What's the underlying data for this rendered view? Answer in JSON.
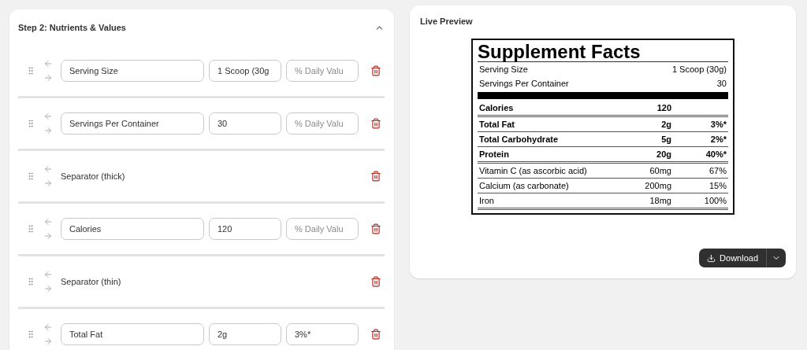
{
  "editor": {
    "title": "Step 2: Nutrients & Values",
    "expanded": true,
    "rows": [
      {
        "kind": "nutrient",
        "name": "Serving Size",
        "amount": "1 Scoop (30g",
        "daily_placeholder": "% Daily Valu"
      },
      {
        "kind": "nutrient",
        "name": "Servings Per Container",
        "amount": "30",
        "daily_placeholder": "% Daily Valu"
      },
      {
        "kind": "separator",
        "label": "Separator (thick)"
      },
      {
        "kind": "nutrient",
        "name": "Calories",
        "amount": "120",
        "daily_placeholder": "% Daily Valu"
      },
      {
        "kind": "separator",
        "label": "Separator (thin)"
      },
      {
        "kind": "nutrient",
        "name": "Total Fat",
        "amount": "2g",
        "daily": "3%*"
      }
    ]
  },
  "preview": {
    "title": "Live Preview",
    "label": {
      "title": "Supplement Facts",
      "lines": [
        {
          "kind": "serving",
          "name": "Serving Size",
          "amount": "1 Scoop (30g)"
        },
        {
          "kind": "serving",
          "name": "Servings Per Container",
          "amount": "30"
        },
        {
          "kind": "bar"
        },
        {
          "kind": "nutrient",
          "name": "Calories",
          "amount": "120",
          "bold": true,
          "double_rule": true
        },
        {
          "kind": "nutrient",
          "name": "Total Fat",
          "amount": "2g",
          "daily": "3%*",
          "bold": true,
          "double_rule": false
        },
        {
          "kind": "nutrient",
          "name": "Total Carbohydrate",
          "amount": "5g",
          "daily": "2%*",
          "bold": true,
          "double_rule": false
        },
        {
          "kind": "nutrient",
          "name": "Protein",
          "amount": "20g",
          "daily": "40%*",
          "bold": true,
          "double_rule": true
        },
        {
          "kind": "nutrient",
          "name": "Vitamin C (as ascorbic acid)",
          "amount": "60mg",
          "daily": "67%",
          "bold": false,
          "double_rule": false
        },
        {
          "kind": "nutrient",
          "name": "Calcium (as carbonate)",
          "amount": "200mg",
          "daily": "15%",
          "bold": false,
          "double_rule": false
        },
        {
          "kind": "nutrient",
          "name": "Iron",
          "amount": "18mg",
          "daily": "100%",
          "bold": false,
          "double_rule": true
        }
      ]
    },
    "download": {
      "label": "Download"
    }
  }
}
